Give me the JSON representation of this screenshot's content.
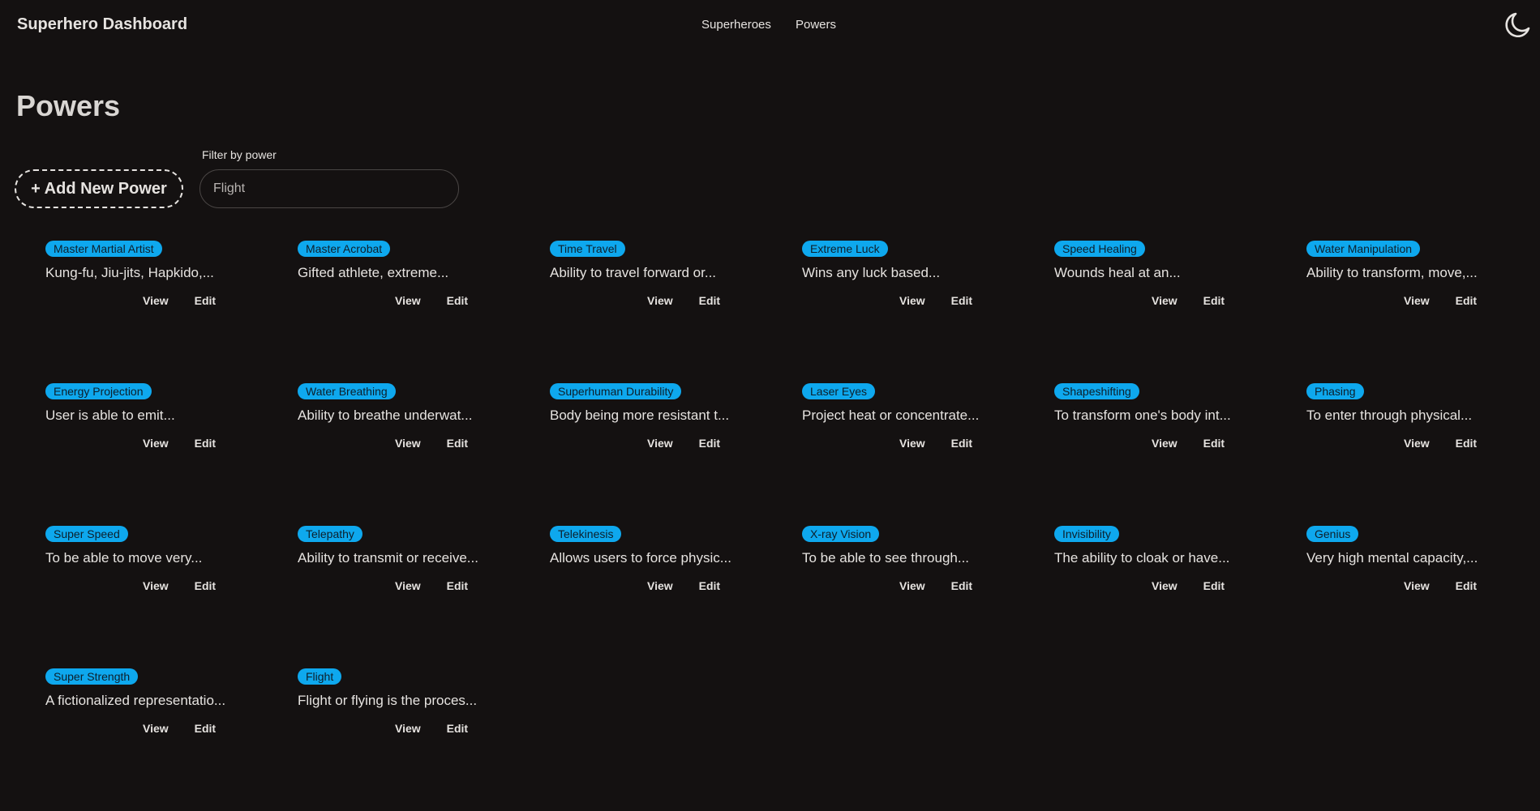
{
  "header": {
    "brand": "Superhero Dashboard",
    "nav": [
      "Superheroes",
      "Powers"
    ],
    "theme_icon": "moon-icon"
  },
  "page": {
    "title": "Powers",
    "add_button": "+ Add New Power",
    "filter_label": "Filter by power",
    "filter_value": "Flight"
  },
  "actions": {
    "view": "View",
    "edit": "Edit"
  },
  "colors": {
    "background": "#141111",
    "tag": "#0ea8ee",
    "text": "#e6e3e0"
  },
  "powers": [
    {
      "name": "Master Martial Artist",
      "description": "Kung-fu, Jiu-jits, Hapkido,..."
    },
    {
      "name": "Master Acrobat",
      "description": "Gifted athlete, extreme..."
    },
    {
      "name": "Time Travel",
      "description": "Ability to travel forward or..."
    },
    {
      "name": "Extreme Luck",
      "description": "Wins any luck based..."
    },
    {
      "name": "Speed Healing",
      "description": "Wounds heal at an..."
    },
    {
      "name": "Water Manipulation",
      "description": "Ability to transform, move,..."
    },
    {
      "name": "Energy Projection",
      "description": "User is able to emit..."
    },
    {
      "name": "Water Breathing",
      "description": "Ability to breathe underwat..."
    },
    {
      "name": "Superhuman Durability",
      "description": "Body being more resistant t..."
    },
    {
      "name": "Laser Eyes",
      "description": "Project heat or concentrate..."
    },
    {
      "name": "Shapeshifting",
      "description": "To transform one's body int..."
    },
    {
      "name": "Phasing",
      "description": "To enter through physical..."
    },
    {
      "name": "Super Speed",
      "description": "To be able to move very..."
    },
    {
      "name": "Telepathy",
      "description": "Ability to transmit or receive..."
    },
    {
      "name": "Telekinesis",
      "description": "Allows users to force physic..."
    },
    {
      "name": "X-ray Vision",
      "description": "To be able to see through..."
    },
    {
      "name": "Invisibility",
      "description": "The ability to cloak or have..."
    },
    {
      "name": "Genius",
      "description": "Very high mental capacity,..."
    },
    {
      "name": "Super Strength",
      "description": "A fictionalized representatio..."
    },
    {
      "name": "Flight",
      "description": "Flight or flying is the proces..."
    }
  ]
}
